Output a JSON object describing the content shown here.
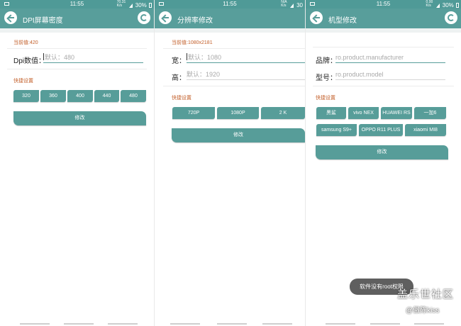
{
  "status_bar": {
    "time": "11:55",
    "net_speed_1": "70.31\nK/s",
    "net_speed_2": "N/A\nK/s",
    "net_speed_3": "0.00\nK/s",
    "battery_1": "30%",
    "battery_2": "30",
    "battery_3": "30%"
  },
  "dpi_screen": {
    "title": "DPI屏幕密度",
    "current": "当前值:420",
    "field_label": "Dpi数值：",
    "field_placeholder": "默认：480",
    "quick_title": "快捷设置",
    "quick_options": [
      "320",
      "360",
      "400",
      "440",
      "480"
    ],
    "submit_label": "修改"
  },
  "resolution_screen": {
    "title": "分辨率修改",
    "current": "当前值:1080x2181",
    "width_label": "宽：",
    "width_placeholder": "默认：1080",
    "height_label": "高：",
    "height_placeholder": "默认：1920",
    "quick_title": "快捷设置",
    "quick_options": [
      "720P",
      "1080P",
      "2 K"
    ],
    "submit_label": "修改"
  },
  "model_screen": {
    "title": "机型修改",
    "brand_label": "品牌：",
    "brand_placeholder": "ro.product.manufacturer",
    "model_label": "型号：",
    "model_placeholder": "ro.product.model",
    "quick_title": "快捷设置",
    "quick_row1": [
      "黑鲨",
      "vivo NEX",
      "HUAWEI RS",
      "一加6"
    ],
    "quick_row2": [
      "samsung S9+",
      "OPPO R11 PLUS",
      "xiaomi MI8"
    ],
    "submit_label": "修改"
  },
  "toast": "软件没有root权限",
  "watermark": {
    "line1": "盖乐世社区",
    "line2": "@傲陈kiss"
  },
  "colors": {
    "primary": "#589e9b",
    "accent_text": "#c35f2a"
  }
}
